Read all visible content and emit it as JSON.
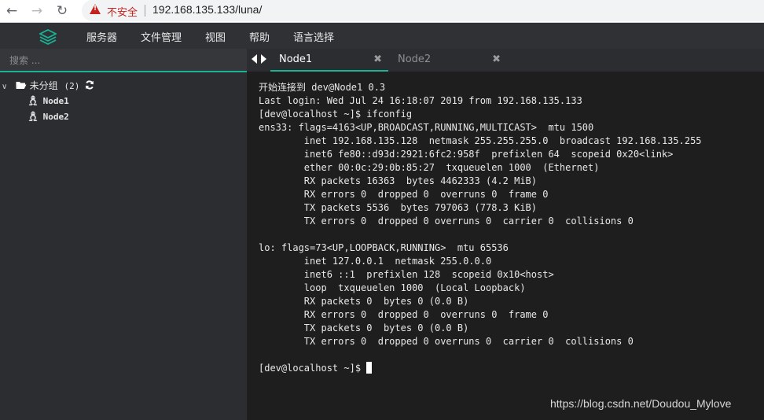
{
  "browser": {
    "back_icon": "←",
    "forward_icon": "→",
    "reload_icon": "↻",
    "security_label": "不安全",
    "url": "192.168.135.133/luna/"
  },
  "menubar": {
    "items": [
      "服务器",
      "文件管理",
      "视图",
      "帮助",
      "语言选择"
    ]
  },
  "sidebar": {
    "search_placeholder": "搜索 ...",
    "group": {
      "toggle": "∨",
      "label": "未分组",
      "count": "(2)"
    },
    "nodes": [
      {
        "label": "Node1"
      },
      {
        "label": "Node2"
      }
    ]
  },
  "tabs": [
    {
      "label": "Node1",
      "close": "✖"
    },
    {
      "label": "Node2",
      "close": "✖"
    }
  ],
  "terminal": {
    "lines": [
      "开始连接到 dev@Node1 0.3",
      "Last login: Wed Jul 24 16:18:07 2019 from 192.168.135.133",
      "[dev@localhost ~]$ ifconfig",
      "ens33: flags=4163<UP,BROADCAST,RUNNING,MULTICAST>  mtu 1500",
      "        inet 192.168.135.128  netmask 255.255.255.0  broadcast 192.168.135.255",
      "        inet6 fe80::d93d:2921:6fc2:958f  prefixlen 64  scopeid 0x20<link>",
      "        ether 00:0c:29:0b:85:27  txqueuelen 1000  (Ethernet)",
      "        RX packets 16363  bytes 4462333 (4.2 MiB)",
      "        RX errors 0  dropped 0  overruns 0  frame 0",
      "        TX packets 5536  bytes 797063 (778.3 KiB)",
      "        TX errors 0  dropped 0 overruns 0  carrier 0  collisions 0",
      "",
      "lo: flags=73<UP,LOOPBACK,RUNNING>  mtu 65536",
      "        inet 127.0.0.1  netmask 255.0.0.0",
      "        inet6 ::1  prefixlen 128  scopeid 0x10<host>",
      "        loop  txqueuelen 1000  (Local Loopback)",
      "        RX packets 0  bytes 0 (0.0 B)",
      "        RX errors 0  dropped 0  overruns 0  frame 0",
      "        TX packets 0  bytes 0 (0.0 B)",
      "        TX errors 0  dropped 0 overruns 0  carrier 0  collisions 0",
      ""
    ],
    "prompt": "[dev@localhost ~]$ "
  },
  "watermark": "https://blog.csdn.net/Doudou_Mylove"
}
